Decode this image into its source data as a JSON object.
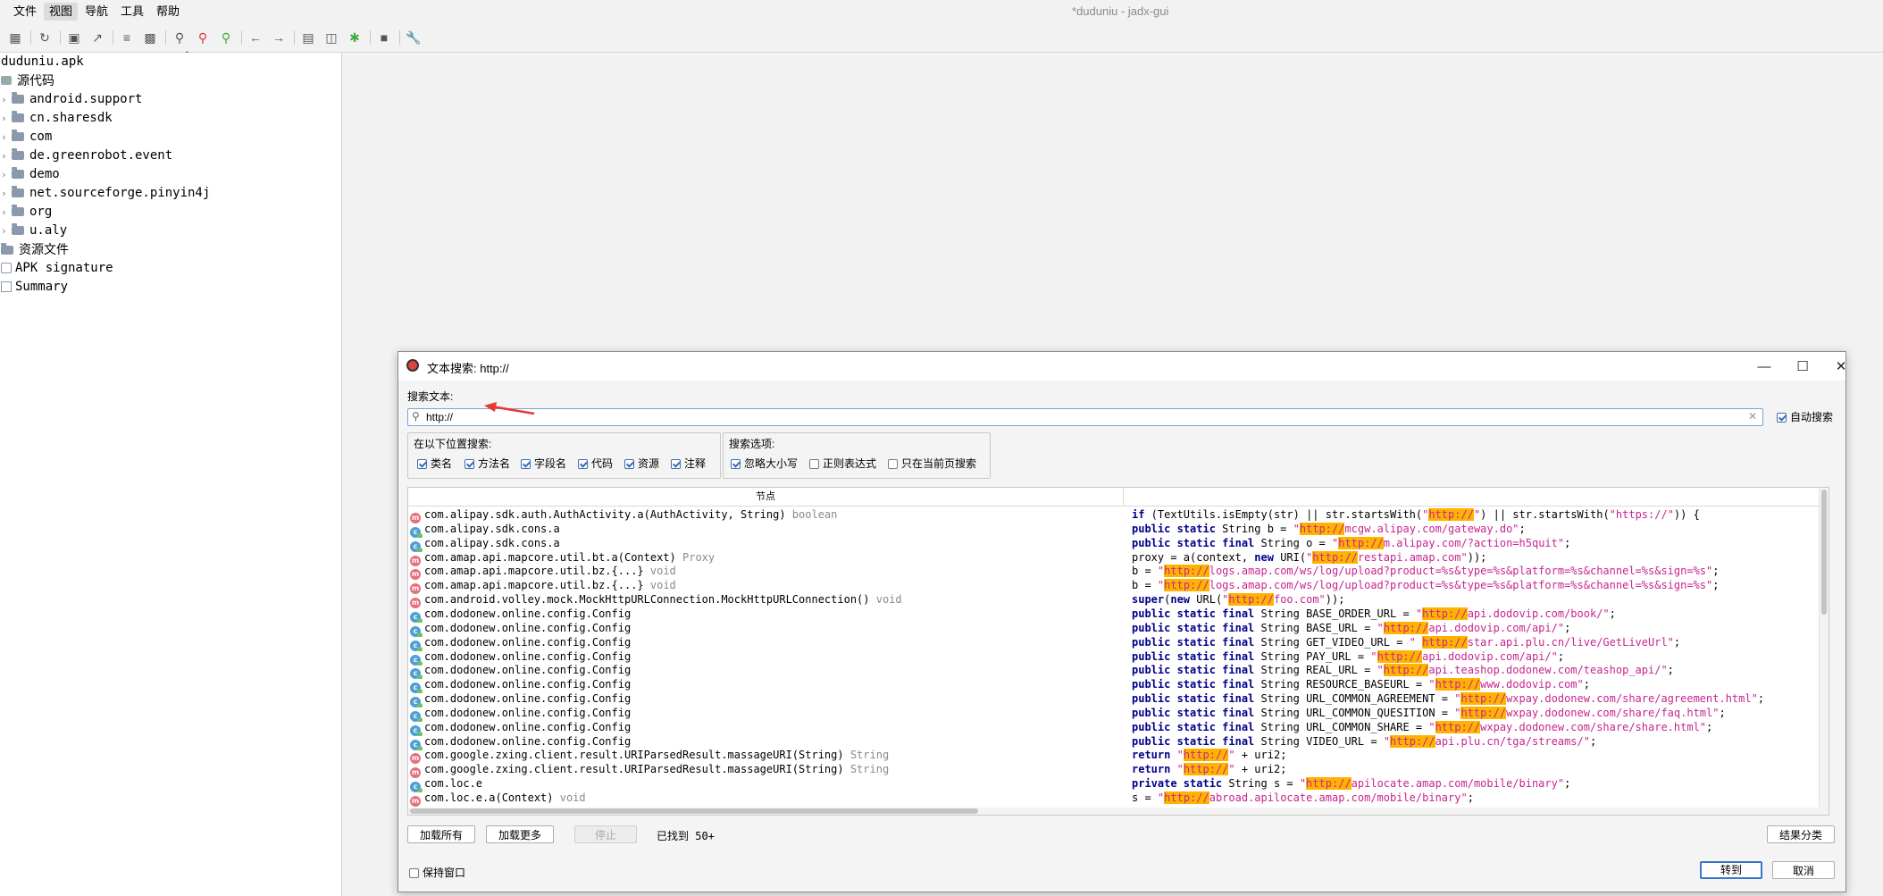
{
  "window_title": "*duduniu - jadx-gui",
  "menu": {
    "items": [
      "文件",
      "视图",
      "导航",
      "工具",
      "帮助"
    ],
    "active_index": 1
  },
  "toolbar": {
    "icons": [
      "open-icon",
      "reload-icon",
      "save-icon",
      "export-icon",
      "sync-icon",
      "tree-icon",
      "search-icon",
      "find-class-icon",
      "find-usage-icon",
      "back-icon",
      "forward-icon",
      "deobfuscate-icon",
      "log-icon",
      "debug-icon",
      "console-icon",
      "settings-icon"
    ]
  },
  "tree": {
    "root": "duduniu.apk",
    "source_label": "源代码",
    "packages": [
      "android.support",
      "cn.sharesdk",
      "com",
      "de.greenrobot.event",
      "demo",
      "net.sourceforge.pinyin4j",
      "org",
      "u.aly"
    ],
    "resources_label": "资源文件",
    "apk_signature": "APK signature",
    "summary": "Summary"
  },
  "dialog": {
    "title": "文本搜索: http://",
    "search_label": "搜索文本:",
    "search_value": "http://",
    "auto_search": "自动搜索",
    "search_in": {
      "title": "在以下位置搜索:",
      "options": [
        {
          "label": "类名",
          "checked": true
        },
        {
          "label": "方法名",
          "checked": true
        },
        {
          "label": "字段名",
          "checked": true
        },
        {
          "label": "代码",
          "checked": true
        },
        {
          "label": "资源",
          "checked": true
        },
        {
          "label": "注释",
          "checked": true
        }
      ]
    },
    "search_options": {
      "title": "搜索选项:",
      "options": [
        {
          "label": "忽略大小写",
          "checked": true
        },
        {
          "label": "正则表达式",
          "checked": false
        },
        {
          "label": "只在当前页搜索",
          "checked": false
        }
      ]
    },
    "results": {
      "column_node": "节点",
      "rows": [
        {
          "kind": "m",
          "node": "com.alipay.sdk.auth.AuthActivity.a(AuthActivity, String)",
          "type": "boolean",
          "code": [
            [
              "kw",
              "if"
            ],
            [
              "t",
              " (TextUtils.isEmpty(str) || str.startsWith("
            ],
            [
              "str",
              "\""
            ],
            [
              "hl",
              "http://"
            ],
            [
              "str",
              "\""
            ],
            [
              "t",
              ") || str.startsWith("
            ],
            [
              "str",
              "\"https://\""
            ],
            [
              "t",
              ")) {"
            ]
          ]
        },
        {
          "kind": "c",
          "node": "com.alipay.sdk.cons.a",
          "type": "",
          "code": [
            [
              "kw",
              "public static "
            ],
            [
              "t",
              "String b = "
            ],
            [
              "str",
              "\""
            ],
            [
              "hl",
              "http://"
            ],
            [
              "str",
              "mcgw.alipay.com/gateway.do\""
            ],
            [
              "t",
              ";"
            ]
          ]
        },
        {
          "kind": "c",
          "node": "com.alipay.sdk.cons.a",
          "type": "",
          "code": [
            [
              "kw",
              "public static final "
            ],
            [
              "t",
              "String o = "
            ],
            [
              "str",
              "\""
            ],
            [
              "hl",
              "http://"
            ],
            [
              "str",
              "m.alipay.com/?action=h5quit\""
            ],
            [
              "t",
              ";"
            ]
          ]
        },
        {
          "kind": "m",
          "node": "com.amap.api.mapcore.util.bt.a(Context)",
          "type": "Proxy",
          "code": [
            [
              "t",
              "proxy = a(context, "
            ],
            [
              "kw",
              "new"
            ],
            [
              "t",
              " URI("
            ],
            [
              "str",
              "\""
            ],
            [
              "hl",
              "http://"
            ],
            [
              "str",
              "restapi.amap.com\""
            ],
            [
              "t",
              "));"
            ]
          ]
        },
        {
          "kind": "m",
          "node": "com.amap.api.mapcore.util.bz.{...}",
          "type": "void",
          "code": [
            [
              "t",
              "b = "
            ],
            [
              "str",
              "\""
            ],
            [
              "hl",
              "http://"
            ],
            [
              "str",
              "logs.amap.com/ws/log/upload?product=%s&type=%s&platform=%s&channel=%s&sign=%s\""
            ],
            [
              "t",
              ";"
            ]
          ]
        },
        {
          "kind": "m",
          "node": "com.amap.api.mapcore.util.bz.{...}",
          "type": "void",
          "code": [
            [
              "t",
              "b = "
            ],
            [
              "str",
              "\""
            ],
            [
              "hl",
              "http://"
            ],
            [
              "str",
              "logs.amap.com/ws/log/upload?product=%s&type=%s&platform=%s&channel=%s&sign=%s\""
            ],
            [
              "t",
              ";"
            ]
          ]
        },
        {
          "kind": "m",
          "node": "com.android.volley.mock.MockHttpURLConnection.MockHttpURLConnection()",
          "type": "void",
          "code": [
            [
              "kw",
              "super"
            ],
            [
              "t",
              "("
            ],
            [
              "kw",
              "new"
            ],
            [
              "t",
              " URL("
            ],
            [
              "str",
              "\""
            ],
            [
              "hl",
              "http://"
            ],
            [
              "str",
              "foo.com\""
            ],
            [
              "t",
              "));"
            ]
          ]
        },
        {
          "kind": "c",
          "node": "com.dodonew.online.config.Config",
          "type": "",
          "code": [
            [
              "kw",
              "public static final "
            ],
            [
              "t",
              "String BASE_ORDER_URL = "
            ],
            [
              "str",
              "\""
            ],
            [
              "hl",
              "http://"
            ],
            [
              "str",
              "api.dodovip.com/book/\""
            ],
            [
              "t",
              ";"
            ]
          ]
        },
        {
          "kind": "c",
          "node": "com.dodonew.online.config.Config",
          "type": "",
          "code": [
            [
              "kw",
              "public static final "
            ],
            [
              "t",
              "String BASE_URL = "
            ],
            [
              "str",
              "\""
            ],
            [
              "hl",
              "http://"
            ],
            [
              "str",
              "api.dodovip.com/api/\""
            ],
            [
              "t",
              ";"
            ]
          ]
        },
        {
          "kind": "c",
          "node": "com.dodonew.online.config.Config",
          "type": "",
          "code": [
            [
              "kw",
              "public static final "
            ],
            [
              "t",
              "String GET_VIDEO_URL = "
            ],
            [
              "str",
              "\" "
            ],
            [
              "hl",
              "http://"
            ],
            [
              "str",
              "star.api.plu.cn/live/GetLiveUrl\""
            ],
            [
              "t",
              ";"
            ]
          ]
        },
        {
          "kind": "c",
          "node": "com.dodonew.online.config.Config",
          "type": "",
          "code": [
            [
              "kw",
              "public static final "
            ],
            [
              "t",
              "String PAY_URL = "
            ],
            [
              "str",
              "\""
            ],
            [
              "hl",
              "http://"
            ],
            [
              "str",
              "api.dodovip.com/api/\""
            ],
            [
              "t",
              ";"
            ]
          ]
        },
        {
          "kind": "c",
          "node": "com.dodonew.online.config.Config",
          "type": "",
          "code": [
            [
              "kw",
              "public static final "
            ],
            [
              "t",
              "String REAL_URL = "
            ],
            [
              "str",
              "\""
            ],
            [
              "hl",
              "http://"
            ],
            [
              "str",
              "api.teashop.dodonew.com/teashop_api/\""
            ],
            [
              "t",
              ";"
            ]
          ]
        },
        {
          "kind": "c",
          "node": "com.dodonew.online.config.Config",
          "type": "",
          "code": [
            [
              "kw",
              "public static final "
            ],
            [
              "t",
              "String RESOURCE_BASEURL = "
            ],
            [
              "str",
              "\""
            ],
            [
              "hl",
              "http://"
            ],
            [
              "str",
              "www.dodovip.com\""
            ],
            [
              "t",
              ";"
            ]
          ]
        },
        {
          "kind": "c",
          "node": "com.dodonew.online.config.Config",
          "type": "",
          "code": [
            [
              "kw",
              "public static final "
            ],
            [
              "t",
              "String URL_COMMON_AGREEMENT = "
            ],
            [
              "str",
              "\""
            ],
            [
              "hl",
              "http://"
            ],
            [
              "str",
              "wxpay.dodonew.com/share/agreement.html\""
            ],
            [
              "t",
              ";"
            ]
          ]
        },
        {
          "kind": "c",
          "node": "com.dodonew.online.config.Config",
          "type": "",
          "code": [
            [
              "kw",
              "public static final "
            ],
            [
              "t",
              "String URL_COMMON_QUESITION = "
            ],
            [
              "str",
              "\""
            ],
            [
              "hl",
              "http://"
            ],
            [
              "str",
              "wxpay.dodonew.com/share/faq.html\""
            ],
            [
              "t",
              ";"
            ]
          ]
        },
        {
          "kind": "c",
          "node": "com.dodonew.online.config.Config",
          "type": "",
          "code": [
            [
              "kw",
              "public static final "
            ],
            [
              "t",
              "String URL_COMMON_SHARE = "
            ],
            [
              "str",
              "\""
            ],
            [
              "hl",
              "http://"
            ],
            [
              "str",
              "wxpay.dodonew.com/share/share.html\""
            ],
            [
              "t",
              ";"
            ]
          ]
        },
        {
          "kind": "c",
          "node": "com.dodonew.online.config.Config",
          "type": "",
          "code": [
            [
              "kw",
              "public static final "
            ],
            [
              "t",
              "String VIDEO_URL = "
            ],
            [
              "str",
              "\""
            ],
            [
              "hl",
              "http://"
            ],
            [
              "str",
              "api.plu.cn/tga/streams/\""
            ],
            [
              "t",
              ";"
            ]
          ]
        },
        {
          "kind": "m",
          "node": "com.google.zxing.client.result.URIParsedResult.massageURI(String)",
          "type": "String",
          "code": [
            [
              "kw",
              "return "
            ],
            [
              "str",
              "\""
            ],
            [
              "hl",
              "http://"
            ],
            [
              "str",
              "\""
            ],
            [
              "t",
              " + uri2;"
            ]
          ]
        },
        {
          "kind": "m",
          "node": "com.google.zxing.client.result.URIParsedResult.massageURI(String)",
          "type": "String",
          "code": [
            [
              "kw",
              "return "
            ],
            [
              "str",
              "\""
            ],
            [
              "hl",
              "http://"
            ],
            [
              "str",
              "\""
            ],
            [
              "t",
              " + uri2;"
            ]
          ]
        },
        {
          "kind": "c",
          "node": "com.loc.e",
          "type": "",
          "code": [
            [
              "kw",
              "private static "
            ],
            [
              "t",
              "String s = "
            ],
            [
              "str",
              "\""
            ],
            [
              "hl",
              "http://"
            ],
            [
              "str",
              "apilocate.amap.com/mobile/binary\""
            ],
            [
              "t",
              ";"
            ]
          ]
        },
        {
          "kind": "m",
          "node": "com.loc.e.a(Context)",
          "type": "void",
          "code": [
            [
              "t",
              "s = "
            ],
            [
              "str",
              "\""
            ],
            [
              "hl",
              "http://"
            ],
            [
              "str",
              "abroad.apilocate.amap.com/mobile/binary\""
            ],
            [
              "t",
              ";"
            ]
          ]
        }
      ]
    },
    "buttons": {
      "load_all": "加载所有",
      "load_more": "加载更多",
      "stop": "停止",
      "found": "已找到 50+",
      "group": "结果分类",
      "keep_window": "保持窗口",
      "goto": "转到",
      "cancel": "取消"
    }
  }
}
